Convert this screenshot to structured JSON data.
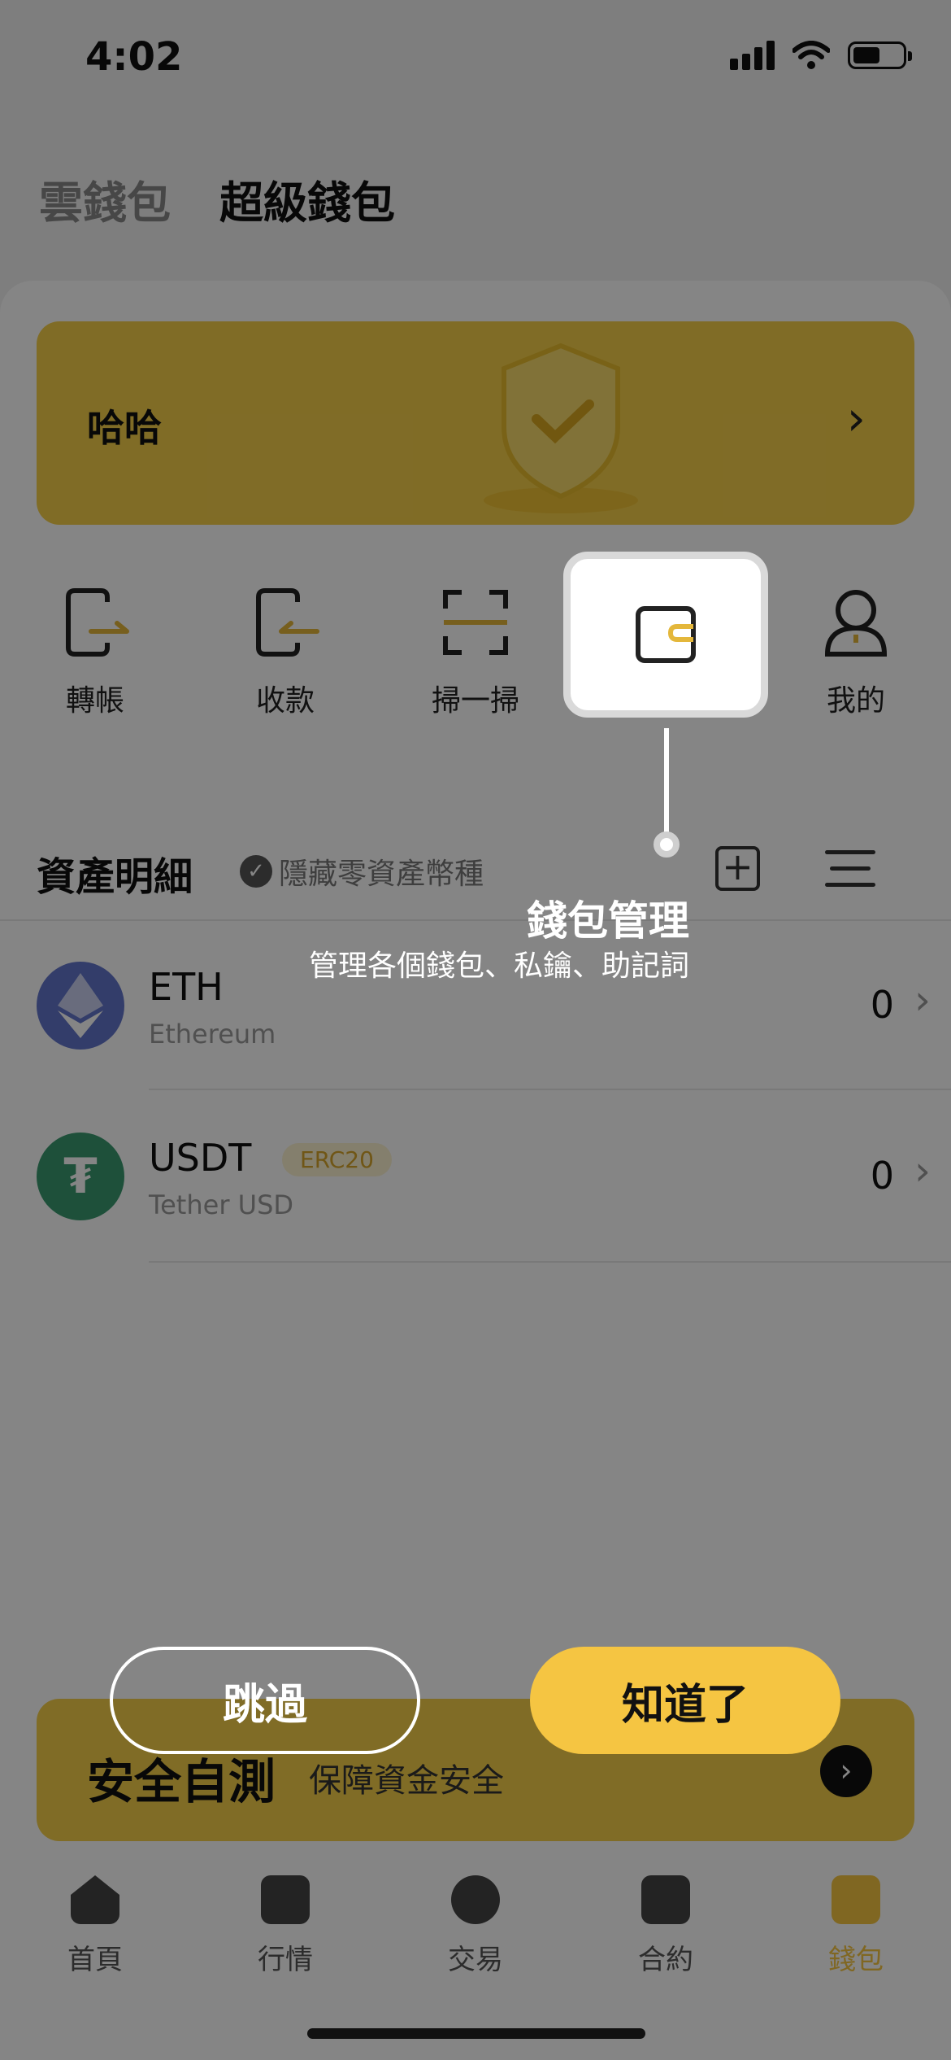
{
  "status_bar": {
    "time": "4:02"
  },
  "top_tabs": {
    "cloud_wallet": "雲錢包",
    "super_wallet": "超級錢包"
  },
  "banner": {
    "title": "哈哈"
  },
  "actions": [
    {
      "label": "轉帳",
      "icon": "transfer-out-icon"
    },
    {
      "label": "收款",
      "icon": "receive-icon"
    },
    {
      "label": "掃一掃",
      "icon": "scan-icon"
    },
    {
      "label": "錢包管理",
      "icon": "wallet-manage-icon"
    },
    {
      "label": "我的",
      "icon": "profile-icon"
    }
  ],
  "assets": {
    "title": "資產明細",
    "hide_zero": "隱藏零資產幣種",
    "coins": [
      {
        "symbol": "ETH",
        "name": "Ethereum",
        "value": "0",
        "color": "#6275cb"
      },
      {
        "symbol": "USDT",
        "name": "Tether USD",
        "value": "0",
        "tag": "ERC20",
        "color": "#3a9a6f"
      }
    ]
  },
  "security": {
    "title": "安全自測",
    "subtitle": "保障資金安全"
  },
  "tabbar": [
    {
      "label": "首頁"
    },
    {
      "label": "行情"
    },
    {
      "label": "交易"
    },
    {
      "label": "合約"
    },
    {
      "label": "錢包"
    }
  ],
  "guide": {
    "title": "錢包管理",
    "subtitle": "管理各個錢包、私鑰、助記詞",
    "skip": "跳過",
    "ok": "知道了"
  },
  "colors": {
    "accent": "#f5c542",
    "banner": "#f5cf4a"
  }
}
